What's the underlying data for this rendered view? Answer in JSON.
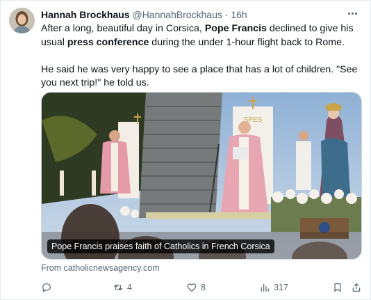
{
  "author": {
    "name": "Hannah Brockhaus",
    "handle": "@HannahBrockhaus",
    "separator": "·",
    "time": "16h"
  },
  "tweet": {
    "p1_a": "After a long, beautiful day in Corsica, ",
    "p1_b": "Pope Francis",
    "p1_c": " declined to give his usual ",
    "p1_d": "press conference",
    "p1_e": " during the under 1-hour flight back to Rome.",
    "p2": "He said he was very happy to see a place that has a lot of children. \"See you next trip!\" he told us."
  },
  "card": {
    "caption": "Pope Francis praises faith of Catholics in French Corsica",
    "source": "From catholicnewsagency.com",
    "banner_text": "SPES"
  },
  "actions": {
    "reply_count": "",
    "retweet_count": "4",
    "like_count": "8",
    "views_count": "317"
  },
  "icons": [
    "more-icon",
    "reply-icon",
    "retweet-icon",
    "like-icon",
    "views-icon",
    "bookmark-icon",
    "share-icon"
  ]
}
